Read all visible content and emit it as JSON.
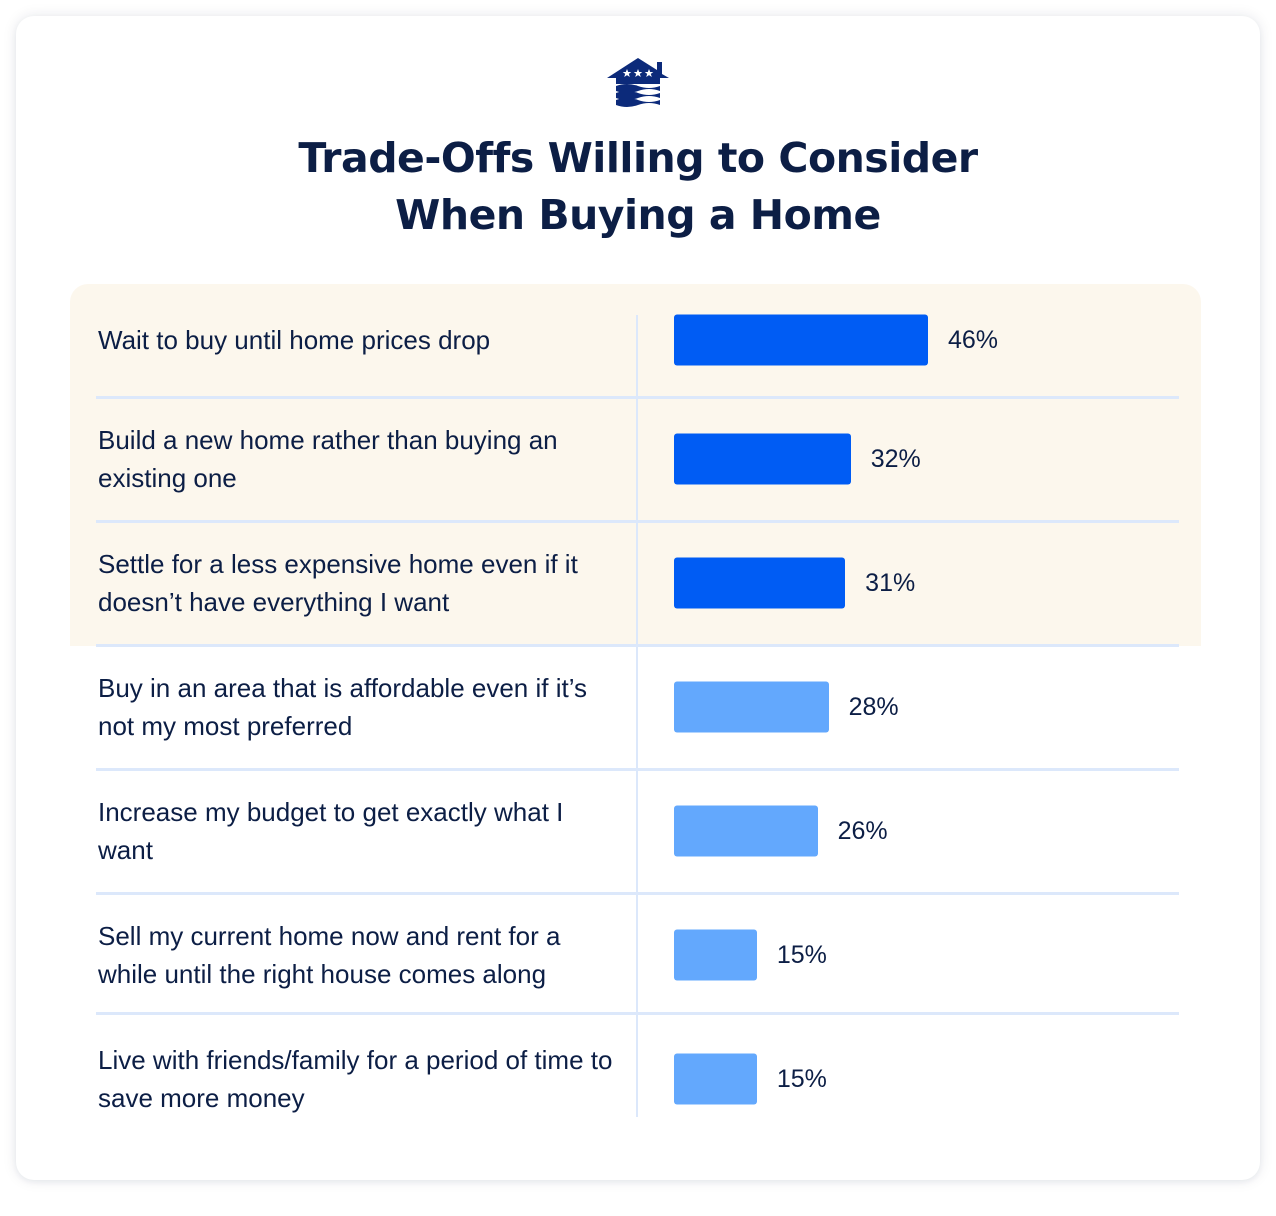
{
  "logo": {
    "icon": "house-stars-waves-icon",
    "color": "#0c2a7a"
  },
  "colors": {
    "primary_bar": "#005cf4",
    "secondary_bar": "#63a8fd",
    "highlight_bg": "#fcf7ed",
    "divider": "#dce8fb",
    "text": "#0c1e45"
  },
  "chart_data": {
    "type": "bar",
    "orientation": "horizontal",
    "title": "Trade-Offs Willing to Consider When Buying a Home",
    "title_lines": [
      "Trade-Offs Willing to Consider",
      "When Buying a Home"
    ],
    "xlabel": "",
    "ylabel": "",
    "xlim": [
      0,
      100
    ],
    "grid": false,
    "legend": "none",
    "highlighted_top_n": 3,
    "categories": [
      "Wait to buy until home prices drop",
      "Build a new home rather than buying an existing one",
      "Settle for a less expensive home even if it doesn’t have everything I want",
      "Buy in an area that is affordable even if it’s not my most preferred",
      "Increase my budget to get exactly what I want",
      "Sell my current home now and rent for a while until the right house comes along",
      "Live with friends/family for a period of time to save more money"
    ],
    "values": [
      46,
      32,
      31,
      28,
      26,
      15,
      15
    ],
    "value_labels": [
      "46%",
      "32%",
      "31%",
      "28%",
      "26%",
      "15%",
      "15%"
    ],
    "unit": "%"
  }
}
